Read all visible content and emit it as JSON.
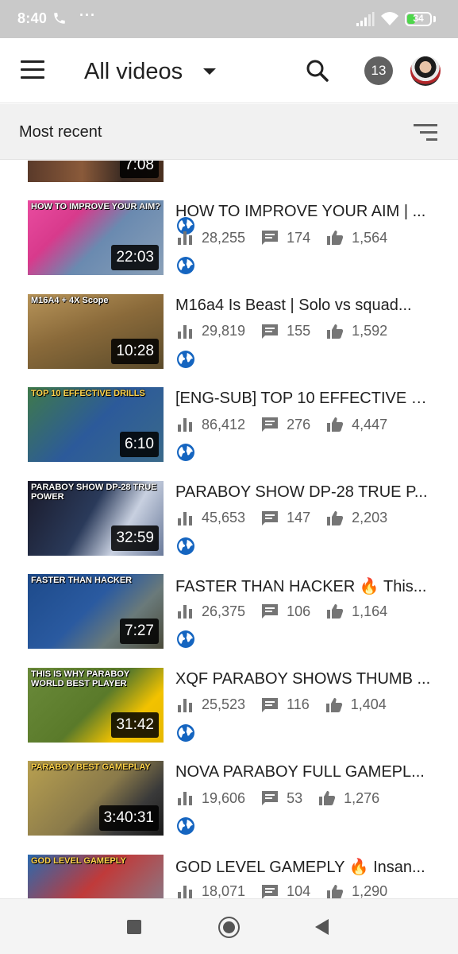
{
  "status_bar": {
    "time": "8:40",
    "dots": "···",
    "battery_level": "34",
    "battery_fraction": 0.34,
    "battery_color": "#4ed64b",
    "icons": [
      "call-icon",
      "signal-icon",
      "wifi-icon",
      "battery-icon"
    ]
  },
  "app_bar": {
    "title": "All videos",
    "notification_count": "13",
    "icons": [
      "menu-icon",
      "dropdown-icon",
      "search-icon",
      "avatar"
    ]
  },
  "sort": {
    "label": "Most recent",
    "icon": "sort-icon"
  },
  "partial_video": {
    "duration": "7:08"
  },
  "videos": [
    {
      "title": "HOW TO IMPROVE YOUR AIM | ...",
      "views": "28,255",
      "comments": "174",
      "likes": "1,564",
      "duration": "22:03",
      "thumb_text": "HOW TO IMPROVE YOUR AIM?"
    },
    {
      "title": "M16a4 Is Beast | Solo vs squad...",
      "views": "29,819",
      "comments": "155",
      "likes": "1,592",
      "duration": "10:28",
      "thumb_text": "M16A4 + 4X Scope"
    },
    {
      "title": "[ENG-SUB] TOP 10 EFFECTIVE D...",
      "views": "86,412",
      "comments": "276",
      "likes": "4,447",
      "duration": "6:10",
      "thumb_text": "TOP 10 EFFECTIVE DRILLS"
    },
    {
      "title": "PARABOY SHOW DP-28 TRUE P...",
      "views": "45,653",
      "comments": "147",
      "likes": "2,203",
      "duration": "32:59",
      "thumb_text": "PARABOY SHOW DP-28 TRUE POWER"
    },
    {
      "title": "FASTER THAN HACKER 🔥 This...",
      "views": "26,375",
      "comments": "106",
      "likes": "1,164",
      "duration": "7:27",
      "thumb_text": "FASTER THAN HACKER"
    },
    {
      "title": "XQF PARABOY SHOWS THUMB ...",
      "views": "25,523",
      "comments": "116",
      "likes": "1,404",
      "duration": "31:42",
      "thumb_text": "THIS IS WHY PARABOY WORLD BEST PLAYER"
    },
    {
      "title": "NOVA PARABOY FULL GAMEPL...",
      "views": "19,606",
      "comments": "53",
      "likes": "1,276",
      "duration": "3:40:31",
      "thumb_text": "PARABOY BEST GAMEPLAY"
    },
    {
      "title": "GOD LEVEL GAMEPLY 🔥 Insan...",
      "views": "18,071",
      "comments": "104",
      "likes": "1,290",
      "duration": "",
      "thumb_text": "GOD LEVEL GAMEPLY"
    }
  ],
  "colors": {
    "globe": "#1565c0",
    "stat_icon": "#757575",
    "status_bar_bg": "#c9c9c9",
    "sort_bar_bg": "#f1f1f1"
  },
  "nav_bar": {
    "icons": [
      "recents-icon",
      "home-icon",
      "back-icon"
    ]
  }
}
